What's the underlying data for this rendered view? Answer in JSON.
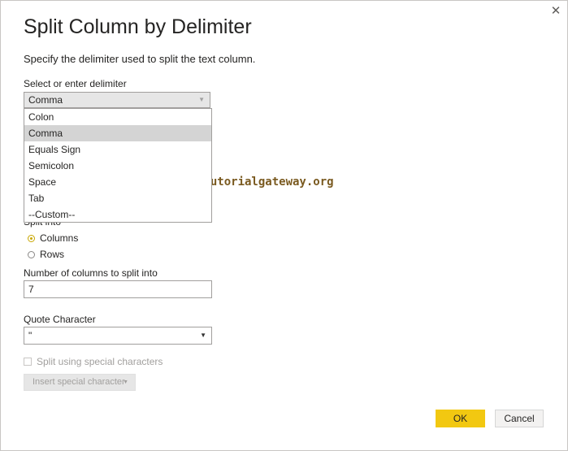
{
  "dialog": {
    "title": "Split Column by Delimiter",
    "subtitle": "Specify the delimiter used to split the text column.",
    "close_glyph": "✕"
  },
  "delimiter": {
    "label": "Select or enter delimiter",
    "value": "Comma",
    "options": [
      "Colon",
      "Comma",
      "Equals Sign",
      "Semicolon",
      "Space",
      "Tab",
      "--Custom--"
    ],
    "selected_option": "Comma"
  },
  "split_into": {
    "label": "Split into",
    "options": [
      {
        "label": "Columns",
        "checked": true
      },
      {
        "label": "Rows",
        "checked": false
      }
    ]
  },
  "columns_count": {
    "label": "Number of columns to split into",
    "value": "7"
  },
  "quote": {
    "label": "Quote Character",
    "value": "\""
  },
  "special": {
    "checkbox_label": "Split using special characters",
    "insert_label": "Insert special character"
  },
  "buttons": {
    "ok": "OK",
    "cancel": "Cancel"
  },
  "watermark": "©tutorialgateway.org",
  "colors": {
    "accent": "#f2c811",
    "radio_checked": "#c8a600",
    "disabled_text": "#a19f9d"
  },
  "icons": {
    "close": "close-icon",
    "dropdown": "chevron-down-icon"
  }
}
